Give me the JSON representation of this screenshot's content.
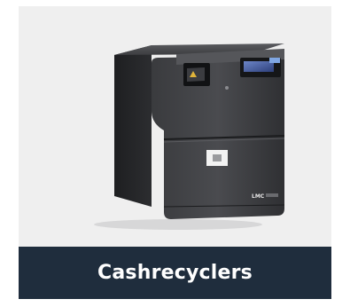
{
  "card": {
    "title": "Cashrecyclers",
    "image_alt": "cash recycler machine",
    "device_logo": "LMC",
    "colors": {
      "caption_bg": "#1f2d3d",
      "caption_text": "#ffffff",
      "image_bg": "#efefef"
    }
  }
}
